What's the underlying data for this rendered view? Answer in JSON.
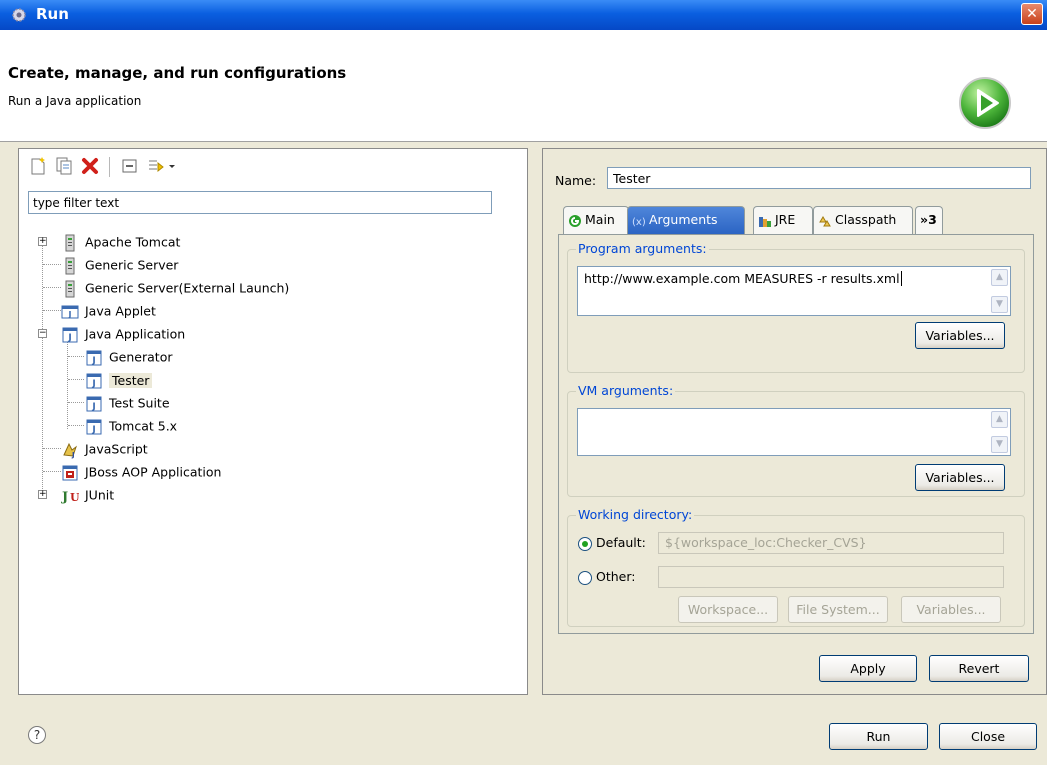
{
  "window": {
    "title": "Run"
  },
  "header": {
    "heading": "Create, manage, and run configurations",
    "subheading": "Run a Java application"
  },
  "filter": {
    "placeholder": "type filter text"
  },
  "tree": {
    "items": [
      {
        "label": "Apache Tomcat",
        "icon": "server-icon"
      },
      {
        "label": "Generic Server",
        "icon": "server-icon"
      },
      {
        "label": "Generic Server(External Launch)",
        "icon": "server-icon"
      },
      {
        "label": "Java Applet",
        "icon": "applet-icon"
      },
      {
        "label": "Java Application",
        "icon": "java-app-icon"
      },
      {
        "label": "Generator",
        "icon": "java-app-icon"
      },
      {
        "label": "Tester",
        "icon": "java-app-icon"
      },
      {
        "label": "Test Suite",
        "icon": "java-app-icon"
      },
      {
        "label": "Tomcat 5.x",
        "icon": "java-app-icon"
      },
      {
        "label": "JavaScript",
        "icon": "javascript-icon"
      },
      {
        "label": "JBoss AOP Application",
        "icon": "jboss-icon"
      },
      {
        "label": "JUnit",
        "icon": "junit-icon"
      }
    ]
  },
  "config": {
    "name_label": "Name:",
    "name_value": "Tester",
    "tabs": [
      {
        "label": "Main"
      },
      {
        "label": "Arguments"
      },
      {
        "label": "JRE"
      },
      {
        "label": "Classpath"
      },
      {
        "label": "»3"
      }
    ],
    "program_args_title": "Program arguments:",
    "program_args_value": "http://www.example.com MEASURES -r results.xml",
    "vm_args_title": "VM arguments:",
    "vm_args_value": "",
    "variables_label": "Variables...",
    "workdir_title": "Working directory:",
    "default_label": "Default:",
    "default_value": "${workspace_loc:Checker_CVS}",
    "other_label": "Other:",
    "other_value": "",
    "workspace_label": "Workspace...",
    "filesystem_label": "File System...",
    "apply_label": "Apply",
    "revert_label": "Revert"
  },
  "footer": {
    "help": "?",
    "run_label": "Run",
    "close_label": "Close"
  },
  "colors": {
    "accent": "#0046d5",
    "titlebar": "#0a5fe0",
    "active_tab": "#2b64c3"
  }
}
